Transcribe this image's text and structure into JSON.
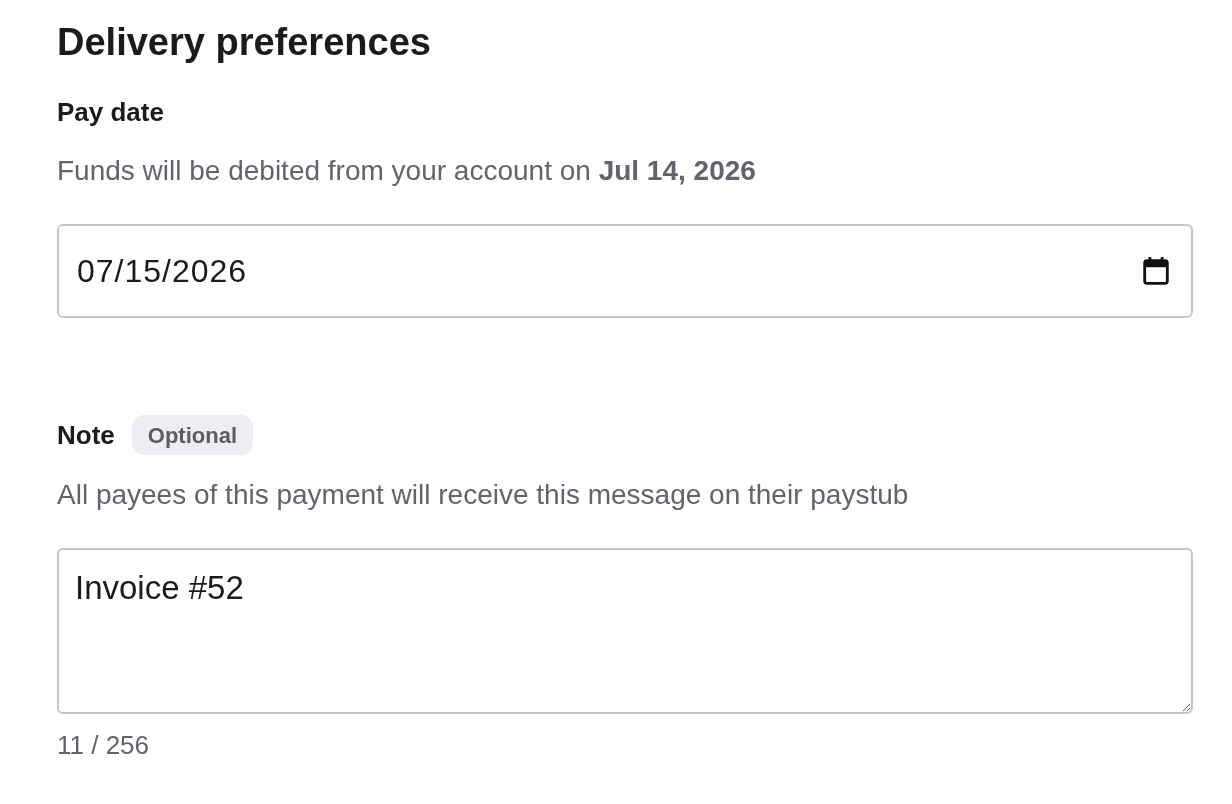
{
  "section": {
    "title": "Delivery preferences"
  },
  "pay_date": {
    "label": "Pay date",
    "description": "Funds will be debited from your account on **Jul 14, 2026**",
    "field": {
      "value": "07/15/2026"
    }
  },
  "note": {
    "label": "Note",
    "badge": "Optional",
    "description": "All payees of this payment will receive this message on their paystub",
    "field": {
      "value": "Invoice #52"
    },
    "counter": "11 / 256"
  }
}
